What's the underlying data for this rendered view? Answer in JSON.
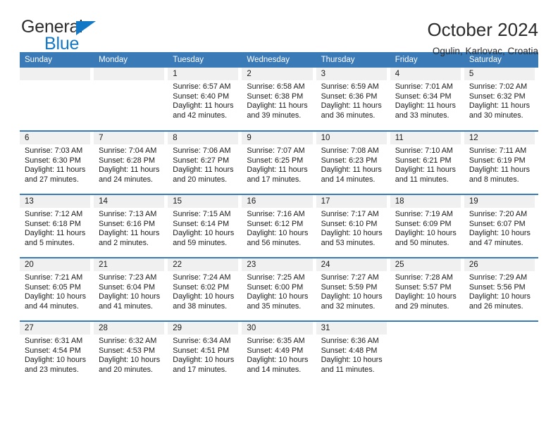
{
  "brand": {
    "name_top": "General",
    "name_bottom": "Blue",
    "accent_color": "#1277c4"
  },
  "header": {
    "title": "October 2024",
    "location": "Ogulin, Karlovac, Croatia"
  },
  "theme": {
    "header_blue": "#3a7ab7",
    "daynum_background": "#f0f0f0",
    "text": "#1a1a1a"
  },
  "calendar": {
    "day_headers": [
      "Sunday",
      "Monday",
      "Tuesday",
      "Wednesday",
      "Thursday",
      "Friday",
      "Saturday"
    ],
    "labels": {
      "sunrise": "Sunrise:",
      "sunset": "Sunset:",
      "daylight": "Daylight:"
    },
    "weeks": [
      [
        {
          "day": "",
          "empty": true
        },
        {
          "day": "",
          "empty": true
        },
        {
          "day": "1",
          "sunrise": "Sunrise: 6:57 AM",
          "sunset": "Sunset: 6:40 PM",
          "daylight_line1": "Daylight: 11 hours",
          "daylight_line2": "and 42 minutes."
        },
        {
          "day": "2",
          "sunrise": "Sunrise: 6:58 AM",
          "sunset": "Sunset: 6:38 PM",
          "daylight_line1": "Daylight: 11 hours",
          "daylight_line2": "and 39 minutes."
        },
        {
          "day": "3",
          "sunrise": "Sunrise: 6:59 AM",
          "sunset": "Sunset: 6:36 PM",
          "daylight_line1": "Daylight: 11 hours",
          "daylight_line2": "and 36 minutes."
        },
        {
          "day": "4",
          "sunrise": "Sunrise: 7:01 AM",
          "sunset": "Sunset: 6:34 PM",
          "daylight_line1": "Daylight: 11 hours",
          "daylight_line2": "and 33 minutes."
        },
        {
          "day": "5",
          "sunrise": "Sunrise: 7:02 AM",
          "sunset": "Sunset: 6:32 PM",
          "daylight_line1": "Daylight: 11 hours",
          "daylight_line2": "and 30 minutes."
        }
      ],
      [
        {
          "day": "6",
          "sunrise": "Sunrise: 7:03 AM",
          "sunset": "Sunset: 6:30 PM",
          "daylight_line1": "Daylight: 11 hours",
          "daylight_line2": "and 27 minutes."
        },
        {
          "day": "7",
          "sunrise": "Sunrise: 7:04 AM",
          "sunset": "Sunset: 6:28 PM",
          "daylight_line1": "Daylight: 11 hours",
          "daylight_line2": "and 24 minutes."
        },
        {
          "day": "8",
          "sunrise": "Sunrise: 7:06 AM",
          "sunset": "Sunset: 6:27 PM",
          "daylight_line1": "Daylight: 11 hours",
          "daylight_line2": "and 20 minutes."
        },
        {
          "day": "9",
          "sunrise": "Sunrise: 7:07 AM",
          "sunset": "Sunset: 6:25 PM",
          "daylight_line1": "Daylight: 11 hours",
          "daylight_line2": "and 17 minutes."
        },
        {
          "day": "10",
          "sunrise": "Sunrise: 7:08 AM",
          "sunset": "Sunset: 6:23 PM",
          "daylight_line1": "Daylight: 11 hours",
          "daylight_line2": "and 14 minutes."
        },
        {
          "day": "11",
          "sunrise": "Sunrise: 7:10 AM",
          "sunset": "Sunset: 6:21 PM",
          "daylight_line1": "Daylight: 11 hours",
          "daylight_line2": "and 11 minutes."
        },
        {
          "day": "12",
          "sunrise": "Sunrise: 7:11 AM",
          "sunset": "Sunset: 6:19 PM",
          "daylight_line1": "Daylight: 11 hours",
          "daylight_line2": "and 8 minutes."
        }
      ],
      [
        {
          "day": "13",
          "sunrise": "Sunrise: 7:12 AM",
          "sunset": "Sunset: 6:18 PM",
          "daylight_line1": "Daylight: 11 hours",
          "daylight_line2": "and 5 minutes."
        },
        {
          "day": "14",
          "sunrise": "Sunrise: 7:13 AM",
          "sunset": "Sunset: 6:16 PM",
          "daylight_line1": "Daylight: 11 hours",
          "daylight_line2": "and 2 minutes."
        },
        {
          "day": "15",
          "sunrise": "Sunrise: 7:15 AM",
          "sunset": "Sunset: 6:14 PM",
          "daylight_line1": "Daylight: 10 hours",
          "daylight_line2": "and 59 minutes."
        },
        {
          "day": "16",
          "sunrise": "Sunrise: 7:16 AM",
          "sunset": "Sunset: 6:12 PM",
          "daylight_line1": "Daylight: 10 hours",
          "daylight_line2": "and 56 minutes."
        },
        {
          "day": "17",
          "sunrise": "Sunrise: 7:17 AM",
          "sunset": "Sunset: 6:10 PM",
          "daylight_line1": "Daylight: 10 hours",
          "daylight_line2": "and 53 minutes."
        },
        {
          "day": "18",
          "sunrise": "Sunrise: 7:19 AM",
          "sunset": "Sunset: 6:09 PM",
          "daylight_line1": "Daylight: 10 hours",
          "daylight_line2": "and 50 minutes."
        },
        {
          "day": "19",
          "sunrise": "Sunrise: 7:20 AM",
          "sunset": "Sunset: 6:07 PM",
          "daylight_line1": "Daylight: 10 hours",
          "daylight_line2": "and 47 minutes."
        }
      ],
      [
        {
          "day": "20",
          "sunrise": "Sunrise: 7:21 AM",
          "sunset": "Sunset: 6:05 PM",
          "daylight_line1": "Daylight: 10 hours",
          "daylight_line2": "and 44 minutes."
        },
        {
          "day": "21",
          "sunrise": "Sunrise: 7:23 AM",
          "sunset": "Sunset: 6:04 PM",
          "daylight_line1": "Daylight: 10 hours",
          "daylight_line2": "and 41 minutes."
        },
        {
          "day": "22",
          "sunrise": "Sunrise: 7:24 AM",
          "sunset": "Sunset: 6:02 PM",
          "daylight_line1": "Daylight: 10 hours",
          "daylight_line2": "and 38 minutes."
        },
        {
          "day": "23",
          "sunrise": "Sunrise: 7:25 AM",
          "sunset": "Sunset: 6:00 PM",
          "daylight_line1": "Daylight: 10 hours",
          "daylight_line2": "and 35 minutes."
        },
        {
          "day": "24",
          "sunrise": "Sunrise: 7:27 AM",
          "sunset": "Sunset: 5:59 PM",
          "daylight_line1": "Daylight: 10 hours",
          "daylight_line2": "and 32 minutes."
        },
        {
          "day": "25",
          "sunrise": "Sunrise: 7:28 AM",
          "sunset": "Sunset: 5:57 PM",
          "daylight_line1": "Daylight: 10 hours",
          "daylight_line2": "and 29 minutes."
        },
        {
          "day": "26",
          "sunrise": "Sunrise: 7:29 AM",
          "sunset": "Sunset: 5:56 PM",
          "daylight_line1": "Daylight: 10 hours",
          "daylight_line2": "and 26 minutes."
        }
      ],
      [
        {
          "day": "27",
          "sunrise": "Sunrise: 6:31 AM",
          "sunset": "Sunset: 4:54 PM",
          "daylight_line1": "Daylight: 10 hours",
          "daylight_line2": "and 23 minutes."
        },
        {
          "day": "28",
          "sunrise": "Sunrise: 6:32 AM",
          "sunset": "Sunset: 4:53 PM",
          "daylight_line1": "Daylight: 10 hours",
          "daylight_line2": "and 20 minutes."
        },
        {
          "day": "29",
          "sunrise": "Sunrise: 6:34 AM",
          "sunset": "Sunset: 4:51 PM",
          "daylight_line1": "Daylight: 10 hours",
          "daylight_line2": "and 17 minutes."
        },
        {
          "day": "30",
          "sunrise": "Sunrise: 6:35 AM",
          "sunset": "Sunset: 4:49 PM",
          "daylight_line1": "Daylight: 10 hours",
          "daylight_line2": "and 14 minutes."
        },
        {
          "day": "31",
          "sunrise": "Sunrise: 6:36 AM",
          "sunset": "Sunset: 4:48 PM",
          "daylight_line1": "Daylight: 10 hours",
          "daylight_line2": "and 11 minutes."
        },
        {
          "day": "",
          "blank": true
        },
        {
          "day": "",
          "blank": true
        }
      ]
    ]
  }
}
